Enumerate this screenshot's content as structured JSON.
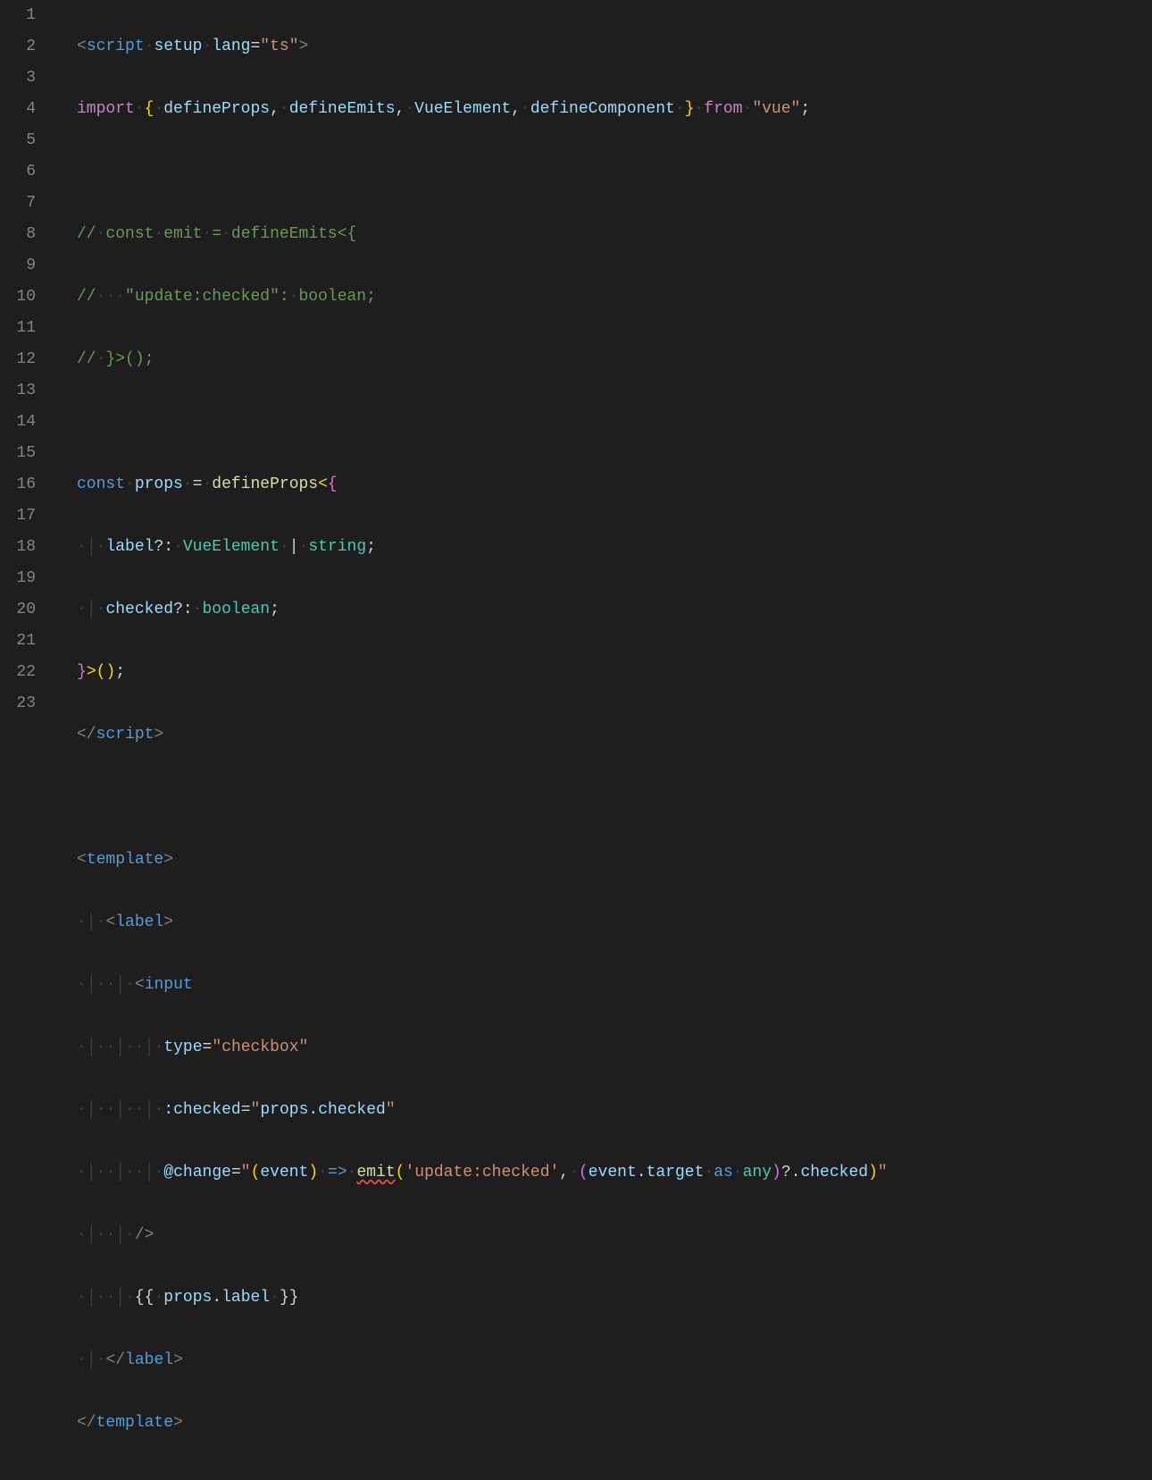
{
  "lineNumbers": [
    "1",
    "2",
    "3",
    "4",
    "5",
    "6",
    "7",
    "8",
    "9",
    "10",
    "11",
    "12",
    "13",
    "14",
    "15",
    "16",
    "17",
    "18",
    "19",
    "20",
    "21",
    "22",
    "23"
  ],
  "code": {
    "l1": {
      "a": "<",
      "b": "script",
      "c": "setup",
      "d": "lang",
      "e": "=",
      "f": "\"ts\"",
      "g": ">"
    },
    "l2": {
      "a": "import",
      "b": "{",
      "c": "defineProps",
      "d": ",",
      "e": "defineEmits",
      "f": ",",
      "g": "VueElement",
      "h": ",",
      "i": "defineComponent",
      "j": "}",
      "k": "from",
      "l": "\"vue\"",
      "m": ";"
    },
    "l4": {
      "a": "//",
      "b": "const",
      "c": "emit",
      "d": "=",
      "e": "defineEmits<{"
    },
    "l5": {
      "a": "//",
      "b": "\"update:checked\":",
      "c": "boolean;"
    },
    "l6": {
      "a": "//",
      "b": "}>();"
    },
    "l8": {
      "a": "const",
      "b": "props",
      "c": "=",
      "d": "defineProps",
      "e": "<",
      "f": "{"
    },
    "l9": {
      "a": "label",
      "b": "?:",
      "c": "VueElement",
      "d": "|",
      "e": "string",
      "f": ";"
    },
    "l10": {
      "a": "checked",
      "b": "?:",
      "c": "boolean",
      "d": ";"
    },
    "l11": {
      "a": "}",
      "b": ">",
      "c": "(",
      "d": ")",
      "e": ";"
    },
    "l12": {
      "a": "</",
      "b": "script",
      "c": ">"
    },
    "l14": {
      "a": "<",
      "b": "template",
      "c": ">"
    },
    "l15": {
      "a": "<",
      "b": "label",
      "c": ">"
    },
    "l16": {
      "a": "<",
      "b": "input"
    },
    "l17": {
      "a": "type",
      "b": "=",
      "c": "\"checkbox\""
    },
    "l18": {
      "a": ":checked",
      "b": "=",
      "c": "\"",
      "d": "props",
      "e": ".",
      "f": "checked",
      "g": "\""
    },
    "l19": {
      "a": "@change",
      "b": "=",
      "c": "\"",
      "d": "(",
      "e": "event",
      "f": ")",
      "g": "=>",
      "h": "emit",
      "i": "(",
      "j": "'update:checked'",
      "k": ",",
      "l": "(",
      "m": "event",
      "n": ".",
      "o": "target",
      "p": "as",
      "q": "any",
      "r": ")",
      "s": "?.",
      "t": "checked",
      "u": ")",
      "v": "\""
    },
    "l20": {
      "a": "/>"
    },
    "l21": {
      "a": "{{",
      "b": "props",
      "c": ".",
      "d": "label",
      "e": "}}"
    },
    "l22": {
      "a": "</",
      "b": "label",
      "c": ">"
    },
    "l23": {
      "a": "</",
      "b": "template",
      "c": ">"
    }
  },
  "wsDot": "·",
  "guide": "│"
}
